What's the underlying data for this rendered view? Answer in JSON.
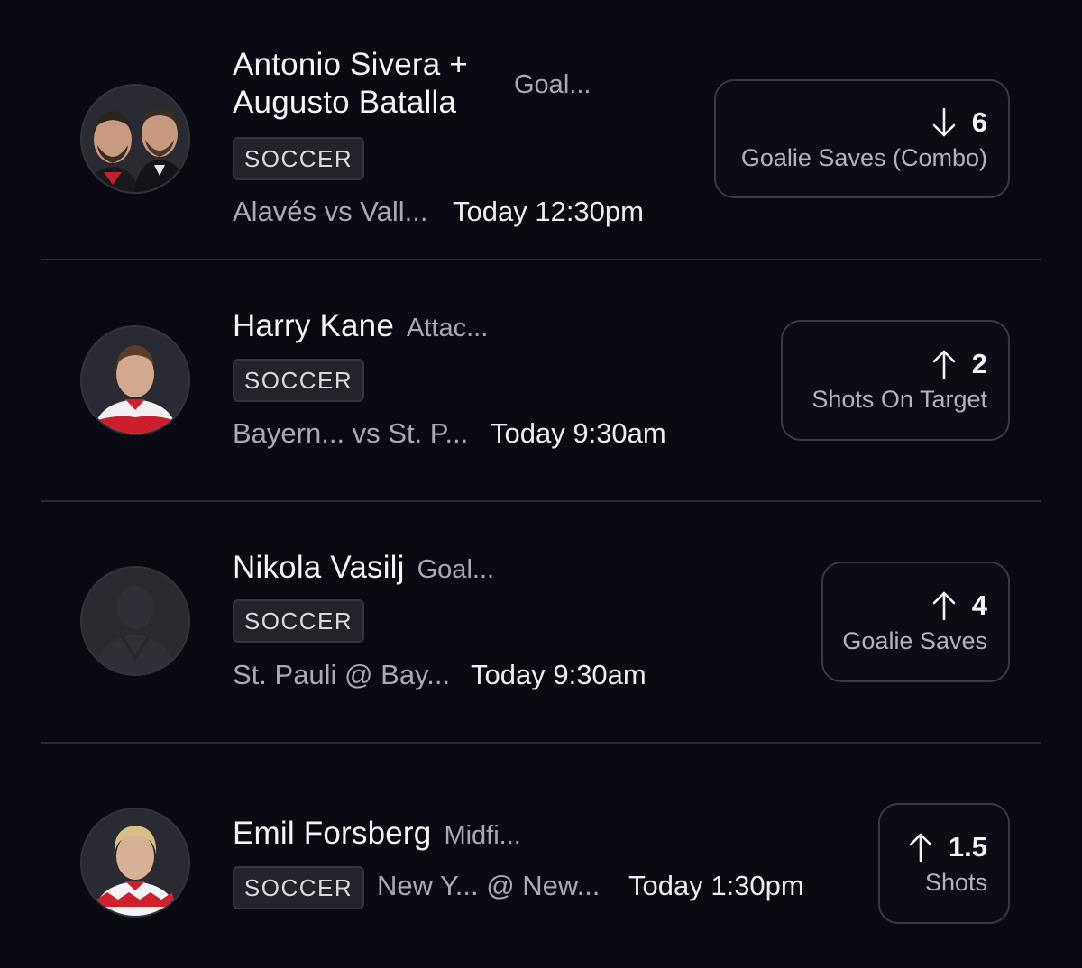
{
  "picks": [
    {
      "name_line1": "Antonio Sivera +",
      "name_line2": "Augusto Batalla",
      "position": "Goal...",
      "sport": "SOCCER",
      "matchup": "Alavés vs Vall...",
      "time": "Today 12:30pm",
      "direction": "down",
      "direction_icon": "arrow-down-icon",
      "value": "6",
      "stat": "Goalie Saves (Combo)"
    },
    {
      "name": "Harry Kane",
      "position": "Attac...",
      "sport": "SOCCER",
      "matchup": "Bayern... vs St. P...",
      "time": "Today 9:30am",
      "direction": "up",
      "direction_icon": "arrow-up-icon",
      "value": "2",
      "stat": "Shots On Target"
    },
    {
      "name": "Nikola Vasilj",
      "position": "Goal...",
      "sport": "SOCCER",
      "matchup": "St. Pauli @ Bay...",
      "time": "Today 9:30am",
      "direction": "up",
      "direction_icon": "arrow-up-icon",
      "value": "4",
      "stat": "Goalie Saves"
    },
    {
      "name": "Emil Forsberg",
      "position": "Midfi...",
      "sport": "SOCCER",
      "matchup": "New Y... @ New...",
      "time": "Today 1:30pm",
      "direction": "up",
      "direction_icon": "arrow-up-icon",
      "value": "1.5",
      "stat": "Shots"
    }
  ],
  "colors": {
    "background": "#0a0a12",
    "divider": "#2b2b33",
    "text_primary": "#f4f4f6",
    "text_secondary": "#a9a9b3",
    "badge_bg": "#23232b",
    "box_border": "#3a3a43"
  }
}
